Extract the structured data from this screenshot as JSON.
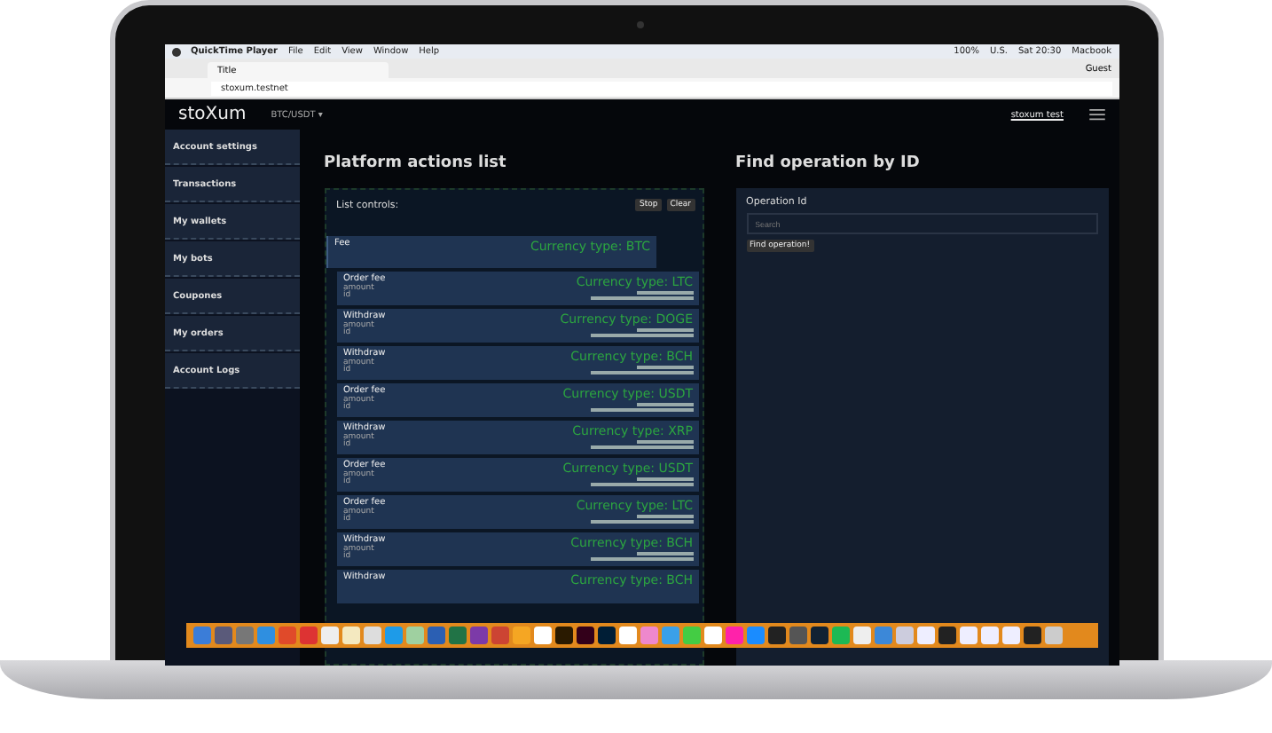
{
  "menu_bar": {
    "app_name": "QuickTime Player",
    "menus": [
      "File",
      "Edit",
      "View",
      "Window",
      "Help"
    ],
    "battery": "100%",
    "input_source": "U.S.",
    "clock": "Sat 20:30",
    "user": "Macbook"
  },
  "browser": {
    "tab_title": "Title",
    "profile": "Guest",
    "address": "stoxum.testnet"
  },
  "app": {
    "logo": "stoXum",
    "pair": "BTC/USDT ▾",
    "account": "stoxum test",
    "sidebar": {
      "items": [
        {
          "label": "Account settings"
        },
        {
          "label": "Transactions"
        },
        {
          "label": "My wallets"
        },
        {
          "label": "My bots"
        },
        {
          "label": "Coupones"
        },
        {
          "label": "My orders"
        },
        {
          "label": "Account Logs"
        }
      ]
    },
    "actions_list": {
      "heading": "Platform actions list",
      "controls_label": "List controls:",
      "buttons": [
        "Stop",
        "Clear"
      ],
      "actions": [
        {
          "title": "Fee",
          "currency": "Currency type: BTC",
          "children": [
            {
              "title": "Order fee",
              "currency": "Currency type: LTC",
              "amount_label": "amount",
              "id_label": "id"
            },
            {
              "title": "Withdraw",
              "currency": "Currency type: DOGE",
              "amount_label": "amount",
              "id_label": "id"
            },
            {
              "title": "Withdraw",
              "currency": "Currency type: BCH",
              "amount_label": "amount",
              "id_label": "id"
            },
            {
              "title": "Order fee",
              "currency": "Currency type: USDT",
              "amount_label": "amount",
              "id_label": "id"
            },
            {
              "title": "Withdraw",
              "currency": "Currency type: XRP",
              "amount_label": "amount",
              "id_label": "id"
            },
            {
              "title": "Order fee",
              "currency": "Currency type: USDT",
              "amount_label": "amount",
              "id_label": "id"
            },
            {
              "title": "Order fee",
              "currency": "Currency type: LTC",
              "amount_label": "amount",
              "id_label": "id"
            },
            {
              "title": "Withdraw",
              "currency": "Currency type: BCH",
              "amount_label": "amount",
              "id_label": "id"
            },
            {
              "title": "Withdraw",
              "currency": "Currency type: BCH"
            }
          ]
        }
      ]
    },
    "find_operation": {
      "heading": "Find operation by ID",
      "field_label": "Operation Id",
      "placeholder": "Search",
      "button": "Find operation!"
    }
  }
}
